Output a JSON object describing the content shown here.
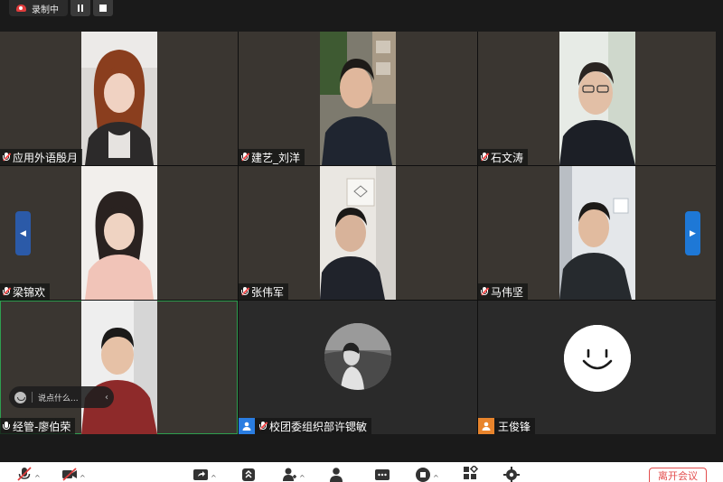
{
  "recording": {
    "label": "录制中"
  },
  "participants": [
    {
      "name": "应用外语殷月",
      "mic": "muted"
    },
    {
      "name": "建艺_刘洋",
      "mic": "muted"
    },
    {
      "name": "石文涛",
      "mic": "muted"
    },
    {
      "name": "梁锦欢",
      "mic": "muted"
    },
    {
      "name": "张伟军",
      "mic": "muted"
    },
    {
      "name": "马伟坚",
      "mic": "muted"
    },
    {
      "name": "经管-廖伯荣",
      "mic": "on",
      "active_speaker": true
    },
    {
      "name": "校团委组织部许锶敏",
      "mic": "muted",
      "badge": "host"
    },
    {
      "name": "王俊锋",
      "mic": "none",
      "badge": "user"
    }
  ],
  "chat": {
    "placeholder": "说点什么..."
  },
  "toolbar": {
    "leave_label": "离开会议"
  },
  "colors": {
    "active_border": "#2e9e4f",
    "nav_arrow": "#1e78d6",
    "leave": "#e34d4d",
    "recording": "#e03c3c"
  }
}
